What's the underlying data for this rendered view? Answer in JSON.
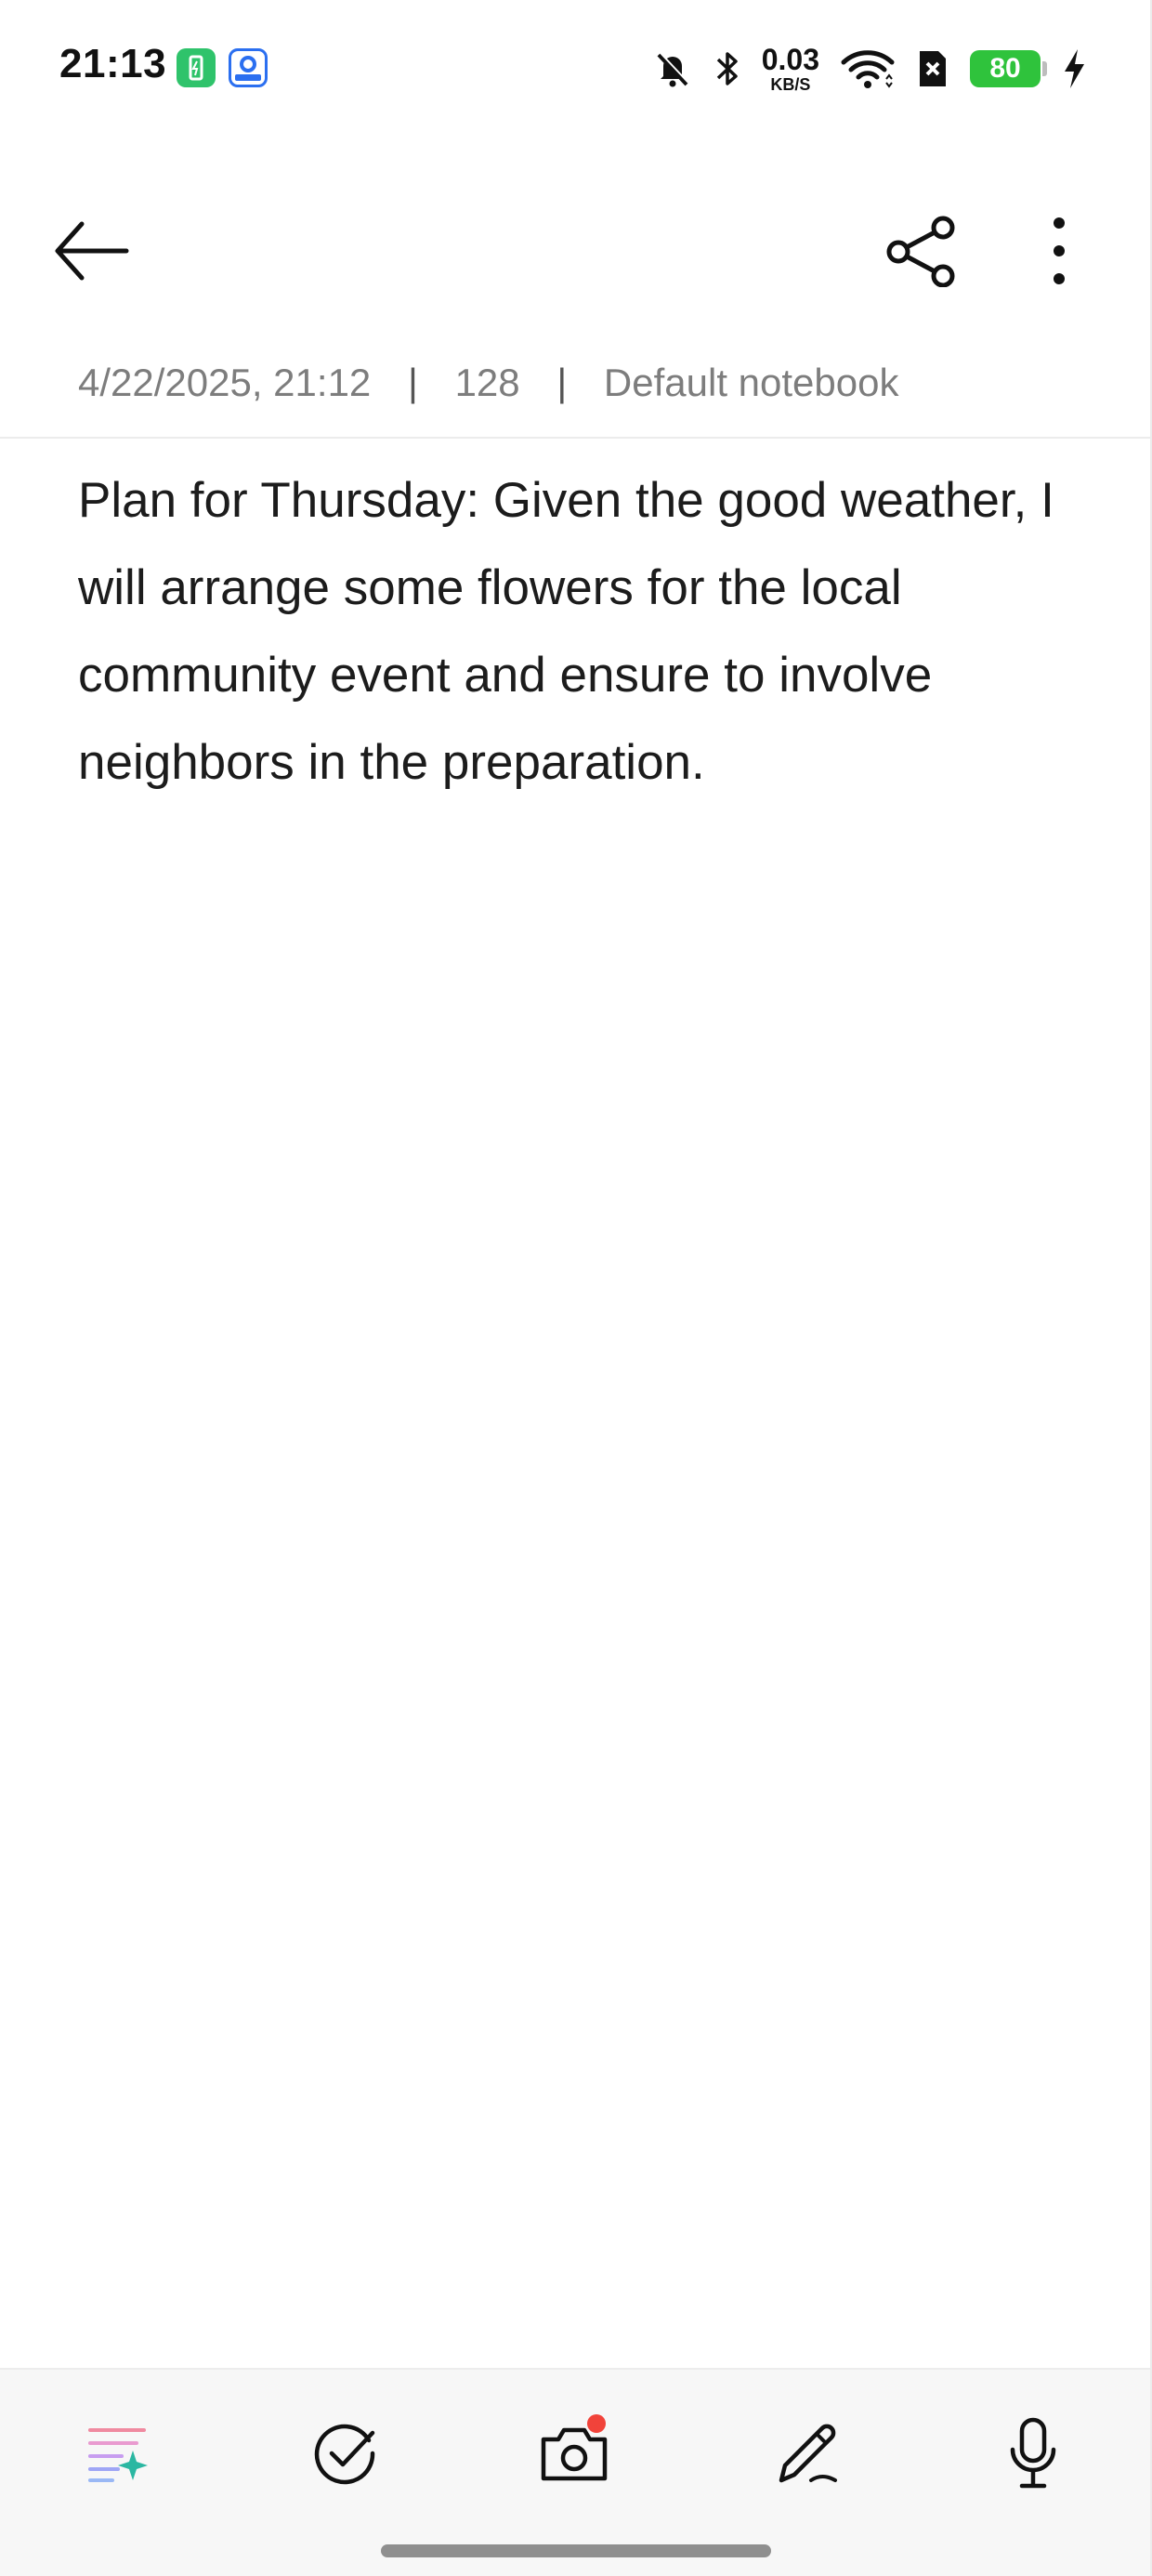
{
  "status_bar": {
    "time": "21:13",
    "net_speed": "0.03",
    "net_speed_unit": "KB/S",
    "battery_level": "80",
    "icons": [
      "charging-app-icon",
      "location-app-icon",
      "mute-icon",
      "bluetooth-icon",
      "wifi-icon",
      "sim-off-icon",
      "charging-bolt-icon"
    ]
  },
  "toolbar": {
    "back_icon": "arrow-left-icon",
    "share_icon": "share-icon",
    "more_icon": "more-vertical-icon"
  },
  "note": {
    "date": "4/22/2025, 21:12",
    "char_count": "128",
    "separator": "|",
    "notebook": "Default notebook",
    "body": "Plan for Thursday: Given the good weather, I will arrange some flowers for the local community event and ensure to involve neighbors in the preparation."
  },
  "bottom_bar": {
    "icons": [
      "text-format-icon",
      "checklist-icon",
      "camera-icon",
      "pen-icon",
      "microphone-icon"
    ],
    "camera_has_notification": true
  },
  "colors": {
    "battery": "#2fc33c",
    "notification_dot": "#f1433a",
    "meta_text": "#7d7d7d"
  }
}
